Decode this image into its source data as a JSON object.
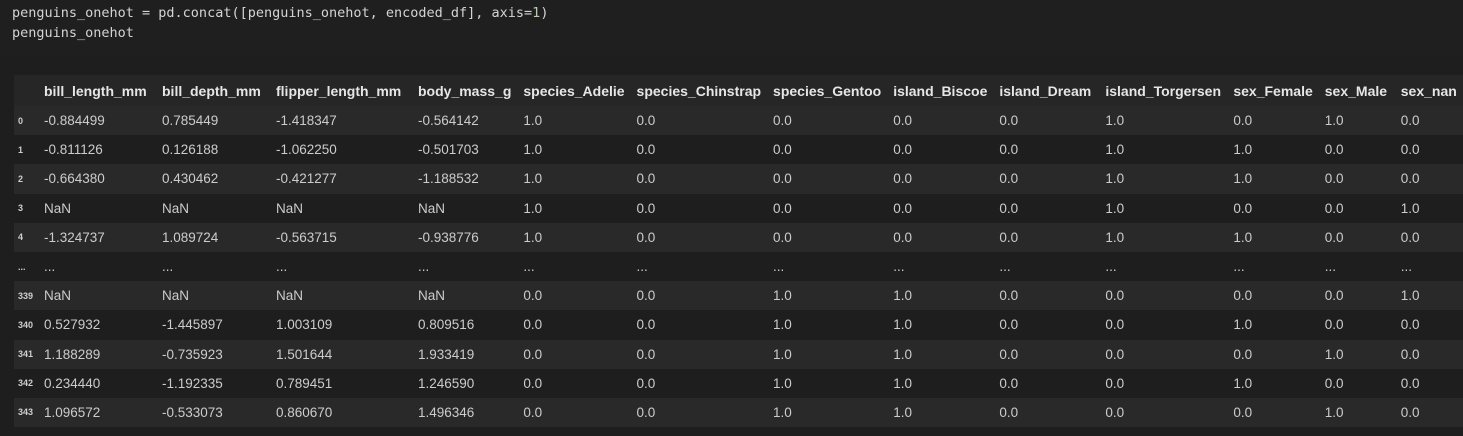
{
  "code": {
    "line1_prefix": "penguins_onehot = pd.concat([penguins_onehot, encoded_df], axis=",
    "line1_num": "1",
    "line1_suffix": ")",
    "line2": "penguins_onehot"
  },
  "table": {
    "columns": [
      "bill_length_mm",
      "bill_depth_mm",
      "flipper_length_mm",
      "body_mass_g",
      "species_Adelie",
      "species_Chinstrap",
      "species_Gentoo",
      "island_Biscoe",
      "island_Dream",
      "island_Torgersen",
      "sex_Female",
      "sex_Male",
      "sex_nan"
    ],
    "rows": [
      {
        "index": "0",
        "cells": [
          "-0.884499",
          "0.785449",
          "-1.418347",
          "-0.564142",
          "1.0",
          "0.0",
          "0.0",
          "0.0",
          "0.0",
          "1.0",
          "0.0",
          "1.0",
          "0.0"
        ]
      },
      {
        "index": "1",
        "cells": [
          "-0.811126",
          "0.126188",
          "-1.062250",
          "-0.501703",
          "1.0",
          "0.0",
          "0.0",
          "0.0",
          "0.0",
          "1.0",
          "1.0",
          "0.0",
          "0.0"
        ]
      },
      {
        "index": "2",
        "cells": [
          "-0.664380",
          "0.430462",
          "-0.421277",
          "-1.188532",
          "1.0",
          "0.0",
          "0.0",
          "0.0",
          "0.0",
          "1.0",
          "1.0",
          "0.0",
          "0.0"
        ]
      },
      {
        "index": "3",
        "cells": [
          "NaN",
          "NaN",
          "NaN",
          "NaN",
          "1.0",
          "0.0",
          "0.0",
          "0.0",
          "0.0",
          "1.0",
          "0.0",
          "0.0",
          "1.0"
        ]
      },
      {
        "index": "4",
        "cells": [
          "-1.324737",
          "1.089724",
          "-0.563715",
          "-0.938776",
          "1.0",
          "0.0",
          "0.0",
          "0.0",
          "0.0",
          "1.0",
          "1.0",
          "0.0",
          "0.0"
        ]
      },
      {
        "index": "...",
        "cells": [
          "...",
          "...",
          "...",
          "...",
          "...",
          "...",
          "...",
          "...",
          "...",
          "...",
          "...",
          "...",
          "..."
        ]
      },
      {
        "index": "339",
        "cells": [
          "NaN",
          "NaN",
          "NaN",
          "NaN",
          "0.0",
          "0.0",
          "1.0",
          "1.0",
          "0.0",
          "0.0",
          "0.0",
          "0.0",
          "1.0"
        ]
      },
      {
        "index": "340",
        "cells": [
          "0.527932",
          "-1.445897",
          "1.003109",
          "0.809516",
          "0.0",
          "0.0",
          "1.0",
          "1.0",
          "0.0",
          "0.0",
          "1.0",
          "0.0",
          "0.0"
        ]
      },
      {
        "index": "341",
        "cells": [
          "1.188289",
          "-0.735923",
          "1.501644",
          "1.933419",
          "0.0",
          "0.0",
          "1.0",
          "1.0",
          "0.0",
          "0.0",
          "0.0",
          "1.0",
          "0.0"
        ]
      },
      {
        "index": "342",
        "cells": [
          "0.234440",
          "-1.192335",
          "0.789451",
          "1.246590",
          "0.0",
          "0.0",
          "1.0",
          "1.0",
          "0.0",
          "0.0",
          "1.0",
          "0.0",
          "0.0"
        ]
      },
      {
        "index": "343",
        "cells": [
          "1.096572",
          "-0.533073",
          "0.860670",
          "1.496346",
          "0.0",
          "0.0",
          "1.0",
          "1.0",
          "0.0",
          "0.0",
          "0.0",
          "1.0",
          "0.0"
        ]
      }
    ]
  },
  "theme": {
    "background": "#1e1e1e",
    "stripe": "#292929",
    "text": "#cccccc",
    "number_token": "#b5cea8"
  }
}
